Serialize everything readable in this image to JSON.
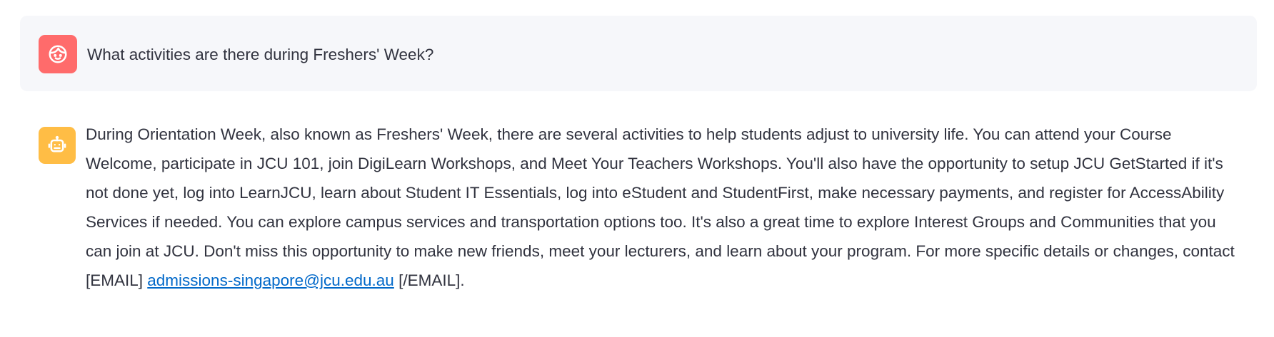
{
  "messages": [
    {
      "role": "user",
      "avatar_icon": "user-face-icon",
      "avatar_color": "#ff6b6b",
      "text": "What activities are there during Freshers' Week?"
    },
    {
      "role": "assistant",
      "avatar_icon": "robot-icon",
      "avatar_color": "#ffbd45",
      "text_before_link": "During Orientation Week, also known as Freshers' Week, there are several activities to help students adjust to university life. You can attend your Course Welcome, participate in JCU 101, join DigiLearn Workshops, and Meet Your Teachers Workshops. You'll also have the opportunity to setup JCU GetStarted if it's not done yet, log into LearnJCU, learn about Student IT Essentials, log into eStudent and StudentFirst, make necessary payments, and register for AccessAbility Services if needed. You can explore campus services and transportation options too. It's also a great time to explore Interest Groups and Communities that you can join at JCU. Don't miss this opportunity to make new friends, meet your lecturers, and learn about your program. For more specific details or changes, contact [EMAIL] ",
      "link_text": "admissions-singapore@jcu.edu.au",
      "text_after_link": " [/EMAIL]."
    }
  ],
  "colors": {
    "text": "#31333f",
    "link": "#0068c9",
    "user_bubble_bg": "#f6f7fa"
  }
}
